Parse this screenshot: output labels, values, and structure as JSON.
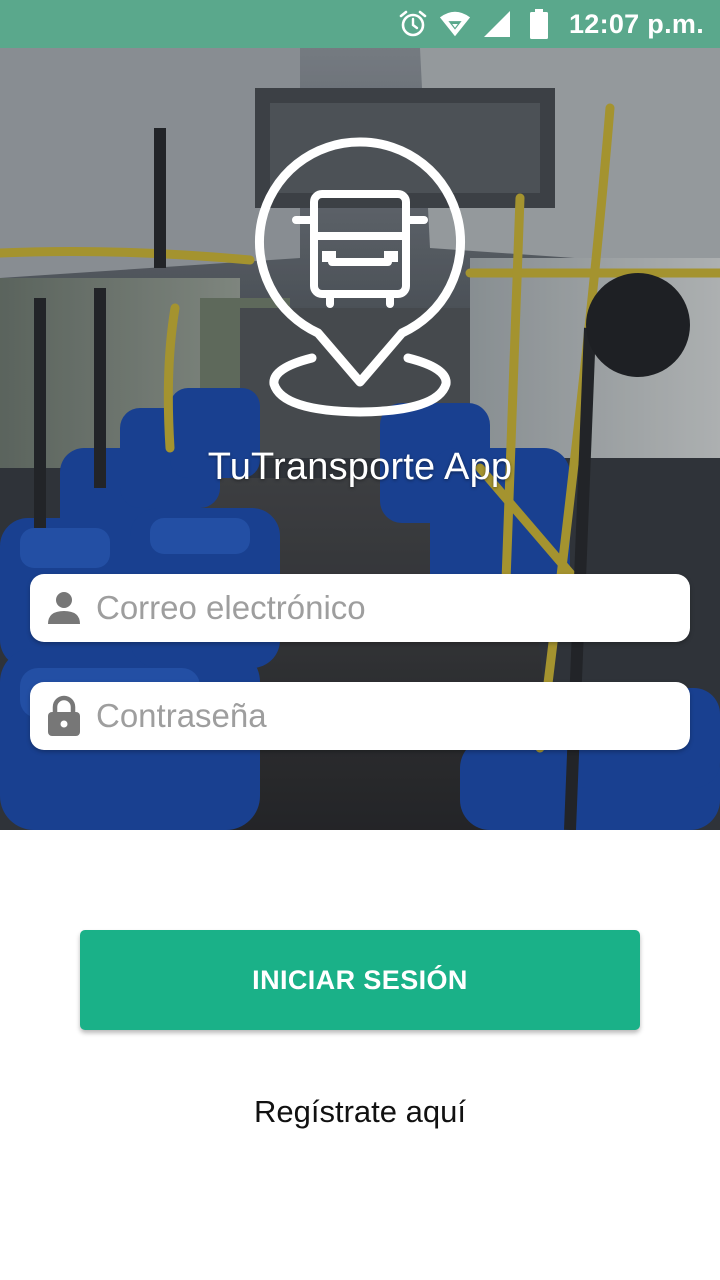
{
  "status_bar": {
    "time": "12:07 p.m.",
    "icons": [
      "alarm-icon",
      "wifi-icon",
      "signal-icon",
      "battery-icon"
    ]
  },
  "app": {
    "title": "TuTransporte App",
    "logo_icon": "bus-location-pin-icon"
  },
  "login_form": {
    "email_placeholder": "Correo electrónico",
    "email_icon": "person-icon",
    "password_placeholder": "Contraseña",
    "password_icon": "lock-icon",
    "submit_label": "INICIAR SESIÓN",
    "register_label": "Regístrate aquí"
  },
  "colors": {
    "status_bar": "#5aa88c",
    "primary_button": "#1ab188",
    "field_background": "#ffffff"
  }
}
